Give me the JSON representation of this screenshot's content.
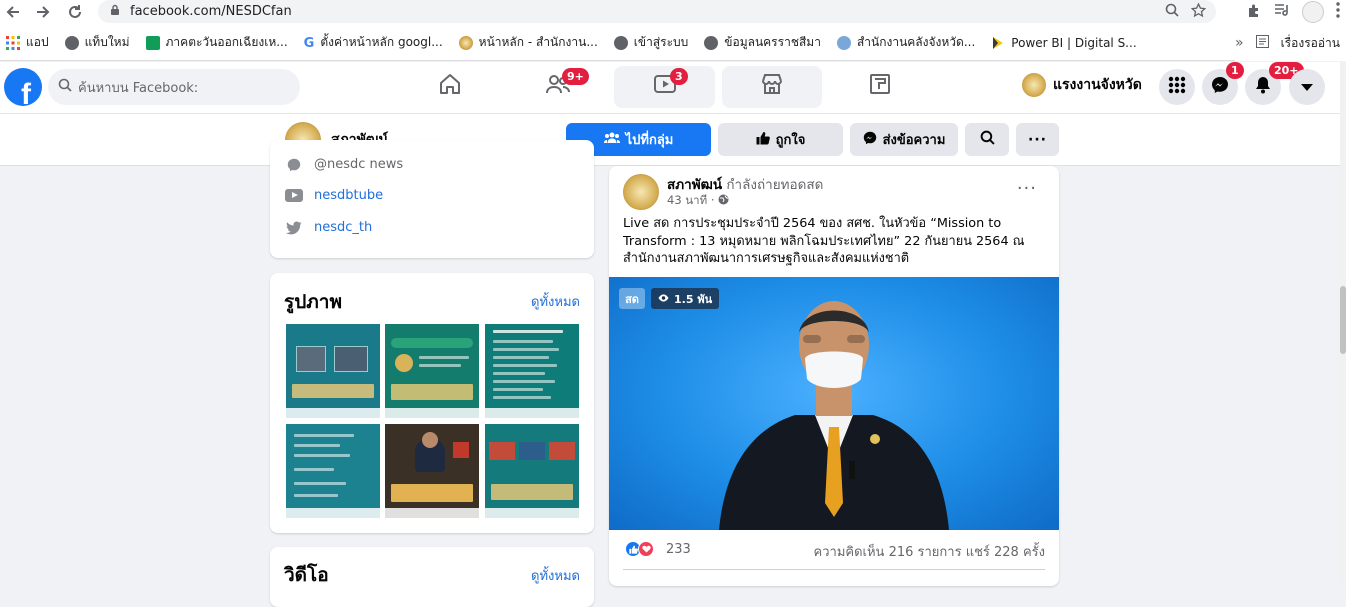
{
  "browser": {
    "url": "facebook.com/NESDCfan",
    "bookmarks": [
      {
        "label": "แอป",
        "color": "#e94235"
      },
      {
        "label": "แท็บใหม่",
        "color": "#5f6368"
      },
      {
        "label": "ภาคตะวันออกเฉียงเห...",
        "color": "#0f9d58"
      },
      {
        "label": "ตั้งค่าหน้าหลัก googl...",
        "color": "#4285f4"
      },
      {
        "label": "หน้าหลัก - สำนักงาน...",
        "color": "#c9a24a"
      },
      {
        "label": "เข้าสู่ระบบ",
        "color": "#5f6368"
      },
      {
        "label": "ข้อมูลนครราชสีมา",
        "color": "#5f6368"
      },
      {
        "label": "สำนักงานคลังจังหวัด...",
        "color": "#7aa7d9"
      },
      {
        "label": "Power BI | Digital S...",
        "color": "#f2c811"
      }
    ],
    "reading_list": "เรื่องรออ่าน",
    "more": "»"
  },
  "fb": {
    "logo": "f",
    "search_placeholder": "ค้นหาบน Facebook:",
    "nav": {
      "friends_badge": "9+",
      "watch_badge": "3"
    },
    "page_switch_name": "แรงงานจังหวัด",
    "messenger_badge": "1",
    "notifications_badge": "20+"
  },
  "page": {
    "name": "สภาพัฒน์",
    "buttons": {
      "group": "ไปที่กลุ่ม",
      "like": "ถูกใจ",
      "message": "ส่งข้อความ"
    }
  },
  "about_links": [
    {
      "label": "@nesdc news",
      "icon": "messenger-icon"
    },
    {
      "label": "nesdbtube",
      "icon": "youtube-icon"
    },
    {
      "label": "nesdc_th",
      "icon": "twitter-icon"
    }
  ],
  "photos": {
    "title": "รูปภาพ",
    "see_all": "ดูทั้งหมด",
    "thumbs": [
      {
        "bg": "#1a7a8a"
      },
      {
        "bg": "#137c6c"
      },
      {
        "bg": "#0e7c78"
      },
      {
        "bg": "#1c8290"
      },
      {
        "bg": "#3a3025"
      },
      {
        "bg": "#147a7c"
      }
    ]
  },
  "videos": {
    "title": "วิดีโอ",
    "see_all": "ดูทั้งหมด"
  },
  "post": {
    "author": "สภาพัฒน์",
    "action": "กำลังถ่ายทอดสด",
    "time": "43 นาที ·",
    "message": "Live สด การประชุมประจำปี 2564 ของ สศช.  ในหัวข้อ “Mission to Transform : 13 หมุดหมาย พลิกโฉมประเทศไทย”  22 กันยายน 2564 ณ สำนักงานสภาพัฒนาการเศรษฐกิจและสังคมแห่งชาติ",
    "live_label": "สด",
    "viewers": "1.5 พัน",
    "reaction_count": "233",
    "stats": "ความคิดเห็น 216 รายการ  แชร์ 228 ครั้ง"
  }
}
